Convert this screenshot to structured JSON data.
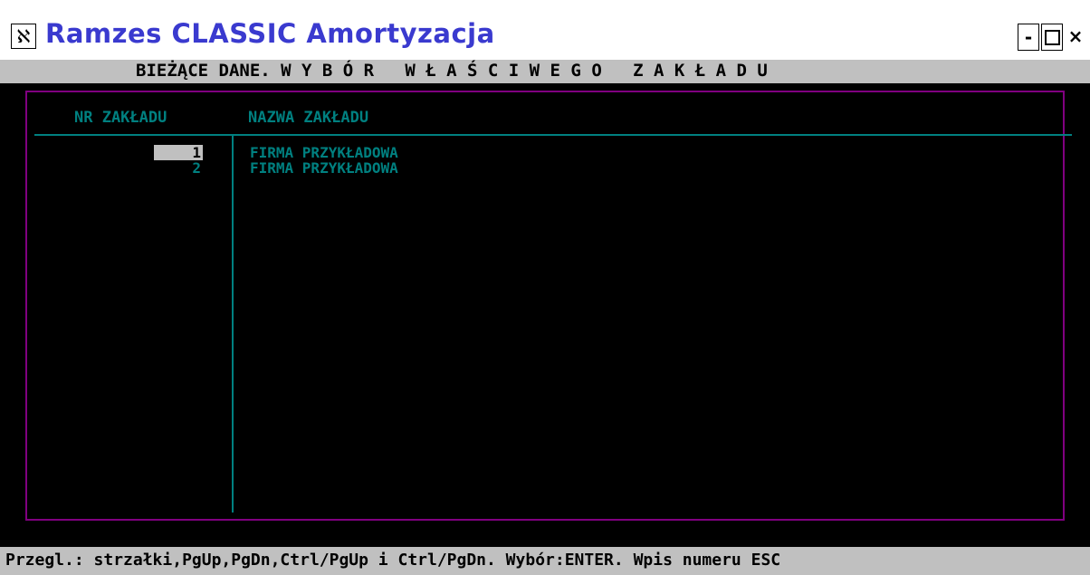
{
  "window": {
    "title": "Ramzes CLASSIC Amortyzacja",
    "icon": "app-icon",
    "minimize_label": "-",
    "close_label": "×"
  },
  "header": {
    "text": "BIEŻĄCE DANE. W Y B Ó R   W Ł A Ś C I W E G O   Z A K Ł A D U"
  },
  "table": {
    "columns": [
      "NR ZAKŁADU",
      "NAZWA ZAKŁADU"
    ],
    "rows": [
      {
        "nr": "1",
        "name": "FIRMA PRZYKŁADOWA",
        "selected": true
      },
      {
        "nr": "2",
        "name": "FIRMA PRZYKŁADOWA",
        "selected": false
      }
    ]
  },
  "status": {
    "text": "Przegl.: strzałki,PgUp,PgDn,Ctrl/PgUp i Ctrl/PgDn. Wybór:ENTER. Wpis numeru ESC"
  },
  "colors": {
    "title": "#3a3acf",
    "frame": "#800080",
    "text": "#008080",
    "bar": "#c0c0c0"
  }
}
